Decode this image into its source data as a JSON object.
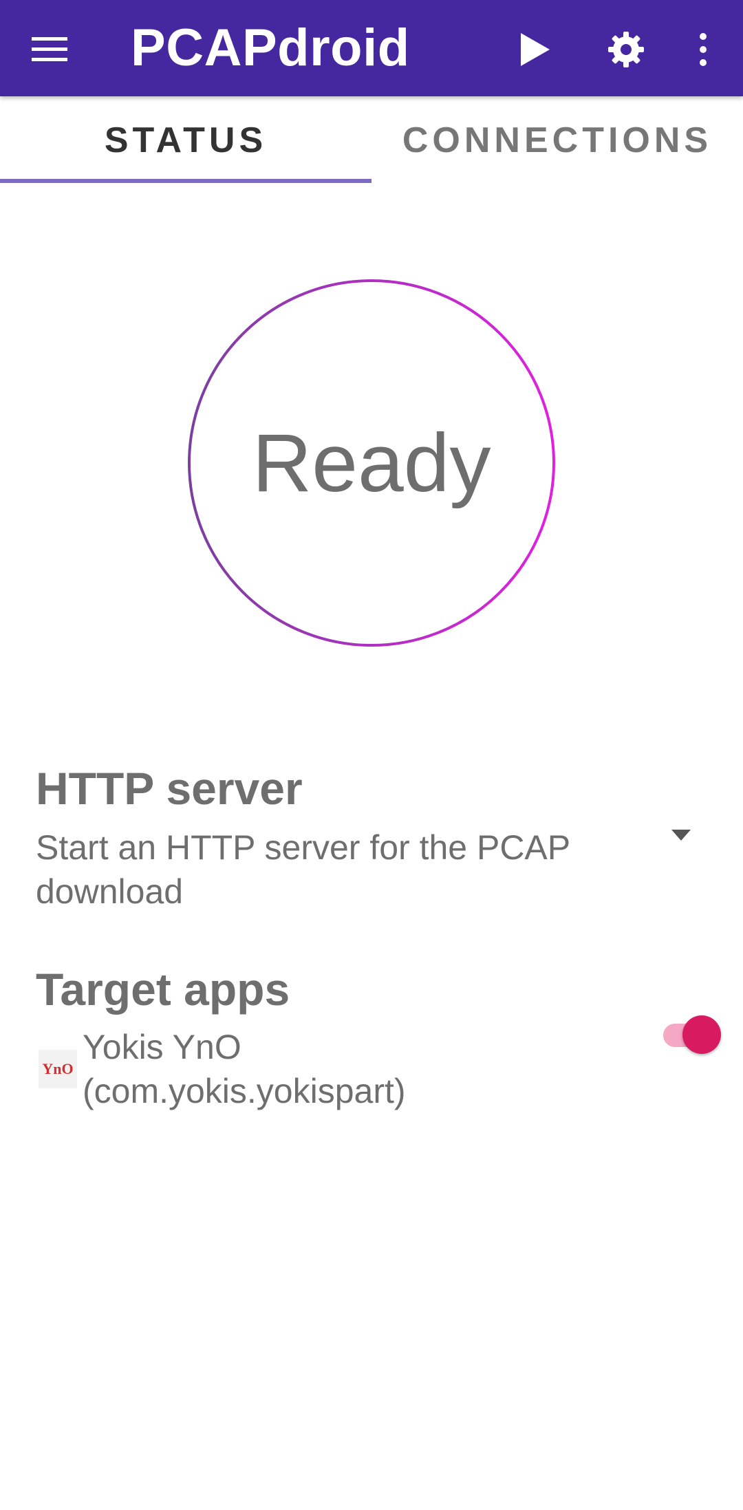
{
  "app": {
    "title": "PCAPdroid",
    "accent_color": "#4527a0",
    "toolbar_icons": [
      "menu-icon",
      "play-icon",
      "settings-icon",
      "more-vert-icon"
    ]
  },
  "tabs": [
    {
      "label": "STATUS",
      "selected": true
    },
    {
      "label": "CONNECTIONS",
      "selected": false
    }
  ],
  "status": {
    "label": "Ready",
    "ring_colors": [
      "#7b3fa0",
      "#e020e0"
    ]
  },
  "http_server": {
    "title": "HTTP server",
    "description": "Start an HTTP server for the PCAP download",
    "dropdown_icon": "arrow-drop-down-icon"
  },
  "target_apps": {
    "title": "Target apps",
    "app_name": "Yokis YnO",
    "app_package": "(com.yokis.yokispart)",
    "app_icon_text": "YnO",
    "switch_on": true,
    "switch_color": "#d81b60"
  }
}
